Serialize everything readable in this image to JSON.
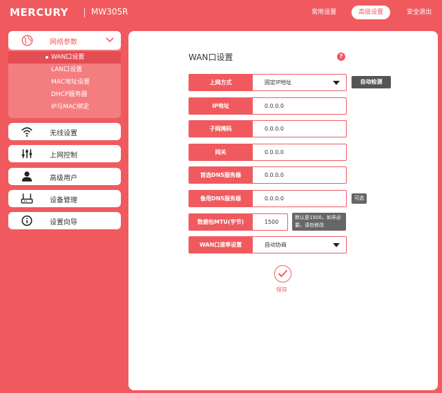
{
  "header": {
    "brand": "MERCURY",
    "model": "MW305R",
    "nav_common": "常用设置",
    "nav_advanced": "高级设置",
    "nav_logout": "安全退出"
  },
  "sidebar": {
    "group_label": "网络参数",
    "sub_items": [
      "WAN口设置",
      "LAN口设置",
      "MAC地址设置",
      "DHCP服务器",
      "IP与MAC绑定"
    ],
    "menus": [
      "无线设置",
      "上网控制",
      "高级用户",
      "设备管理",
      "设置向导"
    ]
  },
  "main": {
    "title": "WAN口设置",
    "help": "?",
    "fields": {
      "conn_type": {
        "label": "上网方式",
        "value": "固定IP地址"
      },
      "ip": {
        "label": "IP地址",
        "value": "0.0.0.0"
      },
      "mask": {
        "label": "子网掩码",
        "value": "0.0.0.0"
      },
      "gateway": {
        "label": "网关",
        "value": "0.0.0.0"
      },
      "dns1": {
        "label": "首选DNS服务器",
        "value": "0.0.0.0"
      },
      "dns2": {
        "label": "备用DNS服务器",
        "value": "0.0.0.0"
      },
      "mtu": {
        "label": "数据包MTU(字节)",
        "value": "1500"
      },
      "speed": {
        "label": "WAN口速率设置",
        "value": "自动协商"
      }
    },
    "auto_detect": "自动检测",
    "optional_tag": "可选",
    "mtu_note": "默认是1500，如非必要，请勿修改",
    "save": "保存"
  },
  "colors": {
    "accent": "#f05a5e",
    "panel": "#ffffff",
    "dark_button": "#555555"
  }
}
